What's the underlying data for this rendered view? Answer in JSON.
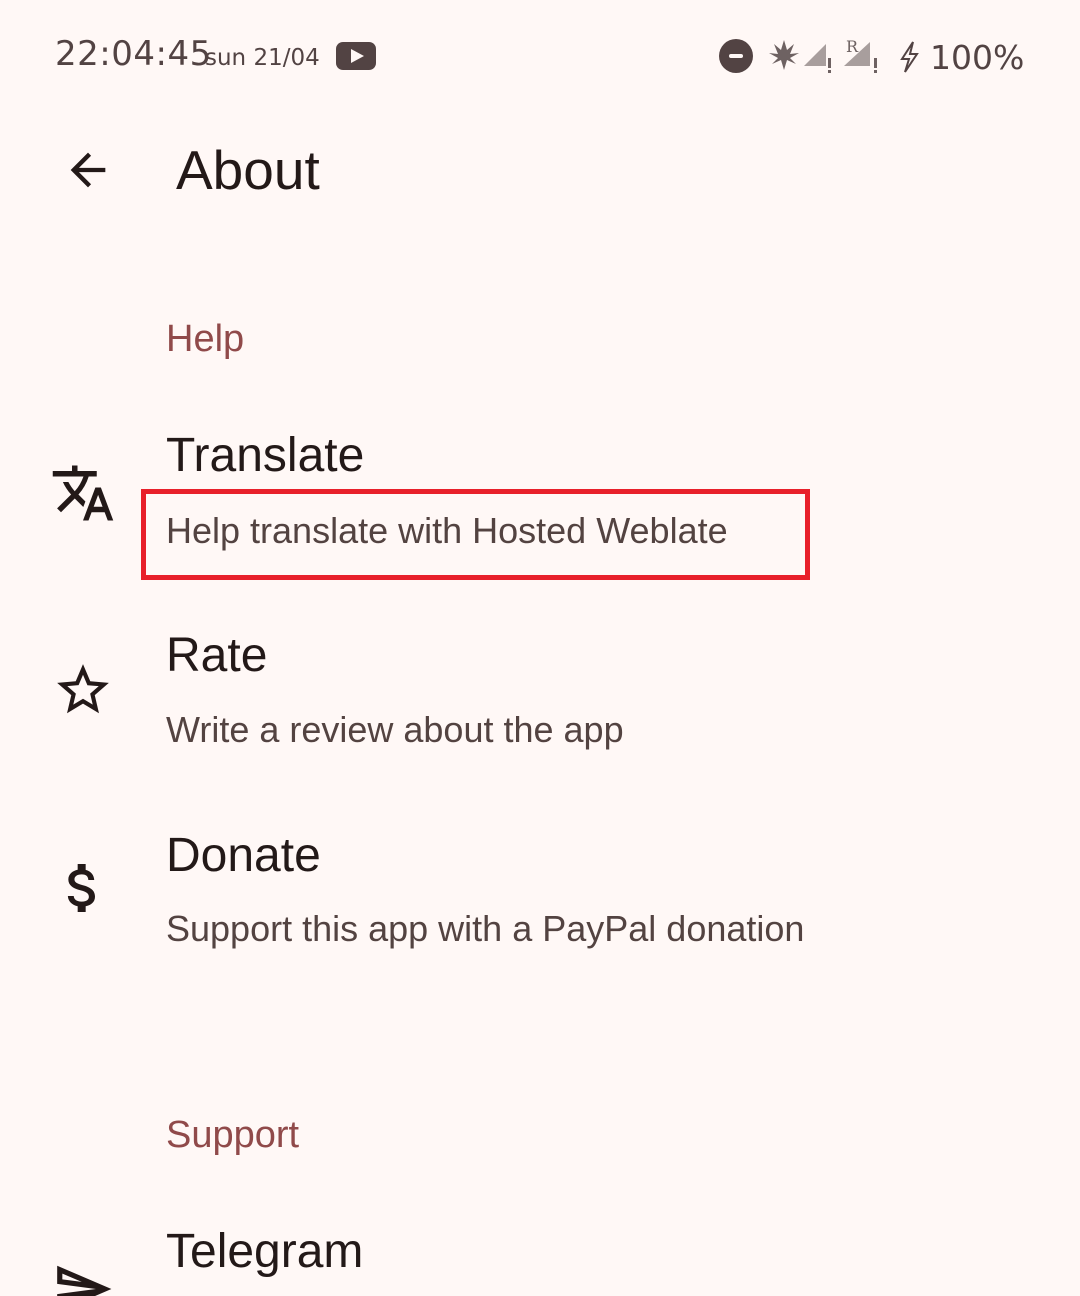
{
  "status_bar": {
    "time": "22:04:45",
    "date": "sun 21/04",
    "battery": "100%"
  },
  "app_bar": {
    "title": "About",
    "back_icon": "arrow-back-icon"
  },
  "sections": [
    {
      "header": "Help",
      "items": [
        {
          "title": "Translate",
          "subtitle": "Help translate with Hosted Weblate",
          "icon": "translate-icon"
        },
        {
          "title": "Rate",
          "subtitle": "Write a review about the app",
          "icon": "star-icon"
        },
        {
          "title": "Donate",
          "subtitle": "Support this app with a PayPal donation",
          "icon": "dollar-icon"
        }
      ]
    },
    {
      "header": "Support",
      "items": [
        {
          "title": "Telegram",
          "icon": "send-icon"
        }
      ]
    }
  ],
  "colors": {
    "background": "#fff8f6",
    "section_header": "#904a4a",
    "highlight": "#e8202a"
  }
}
